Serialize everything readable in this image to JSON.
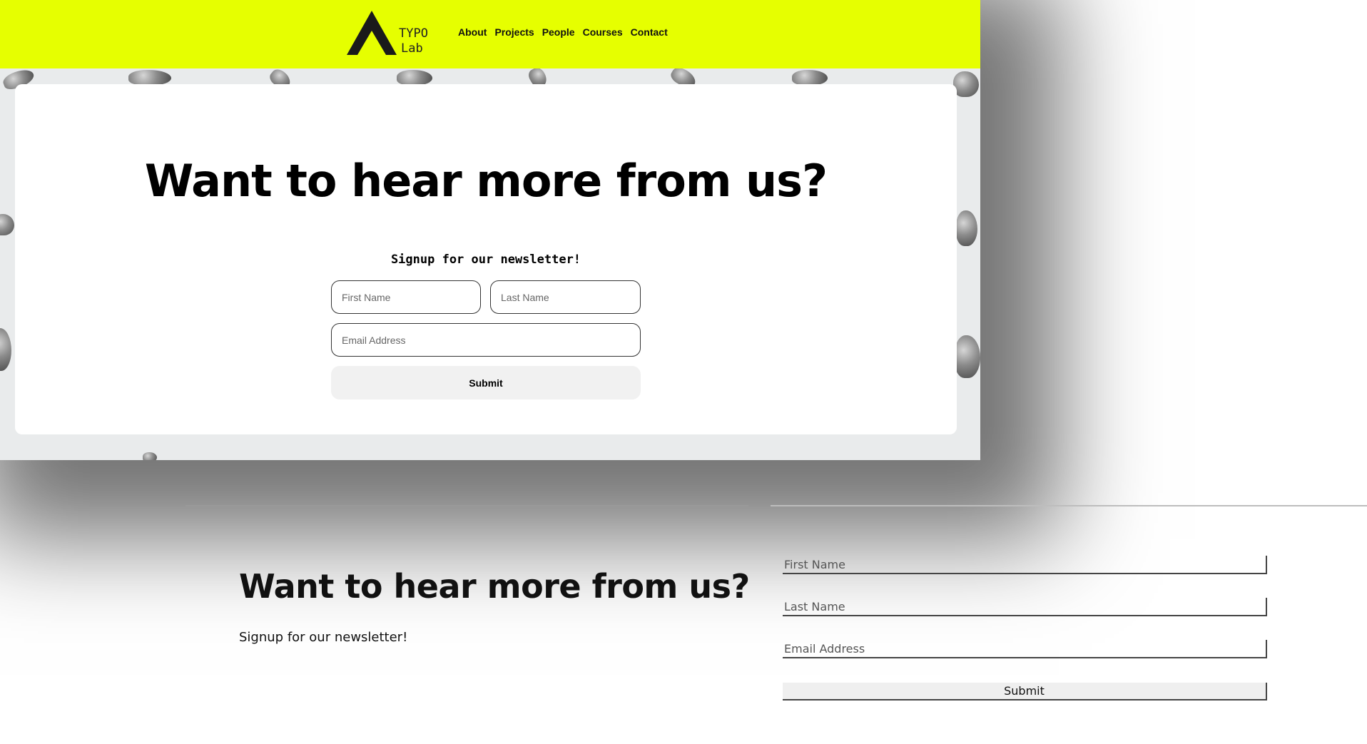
{
  "top_site": {
    "brand": {
      "line1": "TYPO",
      "line2": "Lab"
    },
    "nav": [
      "About",
      "Projects",
      "People",
      "Courses",
      "Contact"
    ],
    "accent_color": "#e6ff00",
    "heading": "Want to hear more from us?",
    "subheading": "Signup for our newsletter!",
    "form": {
      "first_name_placeholder": "First Name",
      "last_name_placeholder": "Last Name",
      "email_placeholder": "Email Address",
      "submit_label": "Submit"
    }
  },
  "bottom_site": {
    "heading": "Want to hear more from us?",
    "subheading": "Signup for our newsletter!",
    "form": {
      "first_name_placeholder": "First Name",
      "last_name_placeholder": "Last Name",
      "email_placeholder": "Email Address",
      "submit_label": "Submit"
    }
  }
}
